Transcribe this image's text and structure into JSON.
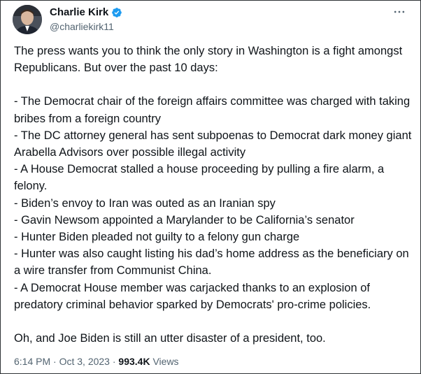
{
  "author": {
    "name": "Charlie Kirk",
    "handle": "@charliekirk11",
    "verified": true
  },
  "tweet": {
    "intro": "The press wants you to think the only story in Washington is a fight amongst Republicans. But over the past 10 days:",
    "items": [
      "- The Democrat chair of the foreign affairs committee was charged with taking bribes from a foreign country",
      "- The DC attorney general has sent subpoenas to Democrat dark money giant Arabella Advisors over possible illegal activity",
      "- A House Democrat stalled a house proceeding by pulling a fire alarm, a felony.",
      "- Biden’s envoy to Iran was outed as an Iranian spy",
      "- Gavin Newsom appointed a Marylander to be California’s senator",
      "- Hunter Biden pleaded not guilty to a felony gun charge",
      "- Hunter was also caught listing his dad’s home address as the beneficiary on a wire transfer from Communist China.",
      "- A Democrat House member was carjacked thanks to an explosion of predatory criminal behavior sparked by Democrats' pro-crime policies."
    ],
    "closing": "Oh, and Joe Biden is still an utter disaster of a president, too."
  },
  "meta": {
    "timestamp": "6:14 PM · Oct 3, 2023",
    "separator": " · ",
    "views_count": "993.4K",
    "views_label": " Views"
  },
  "icons": {
    "more": "more-horizontal-icon",
    "verified": "verified-badge-icon"
  },
  "colors": {
    "text": "#0f1419",
    "secondary": "#536471",
    "verified": "#1d9bf0",
    "border": "#2f3336"
  }
}
